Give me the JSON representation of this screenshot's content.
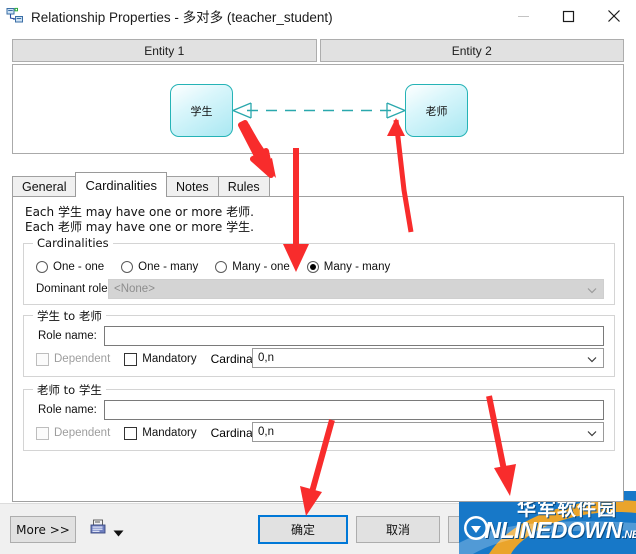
{
  "window": {
    "title": "Relationship Properties - 多对多 (teacher_student)",
    "icon": "relationship-icon",
    "controls": {
      "minimize": "—",
      "maximize": "▢",
      "close": "✕"
    }
  },
  "entity_headers": [
    {
      "label": "Entity 1"
    },
    {
      "label": "Entity 2"
    }
  ],
  "diagram": {
    "entity1": "学生",
    "entity2": "老师",
    "link_style": "dashed",
    "link_color": "#2aa8ad",
    "entity_border_color": "#25b3b6"
  },
  "tabs": [
    {
      "label": "General",
      "active": false
    },
    {
      "label": "Cardinalities",
      "active": true
    },
    {
      "label": "Notes",
      "active": false
    },
    {
      "label": "Rules",
      "active": false
    }
  ],
  "description": {
    "line1": "Each 学生 may have one or more 老师.",
    "line2": "Each 老师 may have one or more 学生."
  },
  "cardinalities": {
    "group_label": "Cardinalities",
    "options": [
      {
        "label": "One - one",
        "selected": false
      },
      {
        "label": "One - many",
        "selected": false
      },
      {
        "label": "Many - one",
        "selected": false
      },
      {
        "label": "Many - many",
        "selected": true
      }
    ],
    "dominant_role_label": "Dominant role:",
    "dominant_role_value": "<None>",
    "dominant_role_disabled": true
  },
  "role_forward": {
    "group_label": "学生 to 老师",
    "role_name_label": "Role name:",
    "role_name_value": "",
    "dependent_label": "Dependent",
    "dependent_checked": false,
    "dependent_disabled": true,
    "mandatory_label": "Mandatory",
    "mandatory_checked": false,
    "cardinality_label": "Cardinality:",
    "cardinality_value": "0,n"
  },
  "role_reverse": {
    "group_label": "老师 to 学生",
    "role_name_label": "Role name:",
    "role_name_value": "",
    "dependent_label": "Dependent",
    "dependent_checked": false,
    "dependent_disabled": true,
    "mandatory_label": "Mandatory",
    "mandatory_checked": false,
    "cardinality_label": "Cardinality:",
    "cardinality_value": "0,n"
  },
  "footer": {
    "more_label": "More >>",
    "print_icon": "printer-icon",
    "print_caret": "▼",
    "ok_label": "确定",
    "cancel_label": "取消",
    "extra_label": "",
    "default_button_color": "#0078d7"
  },
  "watermark": {
    "cn_text": "华军软件园",
    "en_text": "ONLINEDOWN",
    "suffix": ".NET",
    "bg_color": "#1778c8"
  },
  "annotations": {
    "color": "#f82c2c",
    "arrows": [
      {
        "name": "arrow-to-crowsfoot-left",
        "target": "left crow's foot"
      },
      {
        "name": "arrow-to-crowsfoot-right",
        "target": "right crow's foot"
      },
      {
        "name": "arrow-to-many-many-radio",
        "target": "Many - many radio"
      },
      {
        "name": "arrow-to-ok-button",
        "target": "确定 button"
      },
      {
        "name": "arrow-to-watermark",
        "target": "watermark"
      }
    ]
  }
}
